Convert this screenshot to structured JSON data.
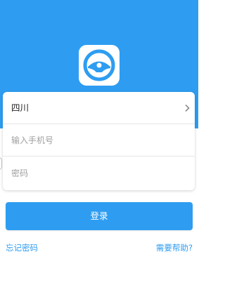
{
  "colors": {
    "brand_blue": "#2e9df1",
    "card_background": "#ffffff",
    "placeholder_gray": "#a0a0a0"
  },
  "logo": {
    "icon": "steering-wheel-icon"
  },
  "form": {
    "region": {
      "value": "四川",
      "icon": "chevron-right-icon"
    },
    "phone": {
      "placeholder": "输入手机号"
    },
    "password": {
      "placeholder": "密码"
    }
  },
  "actions": {
    "login_label": "登录",
    "forgot_password_label": "忘记密码",
    "help_label": "需要帮助?"
  }
}
